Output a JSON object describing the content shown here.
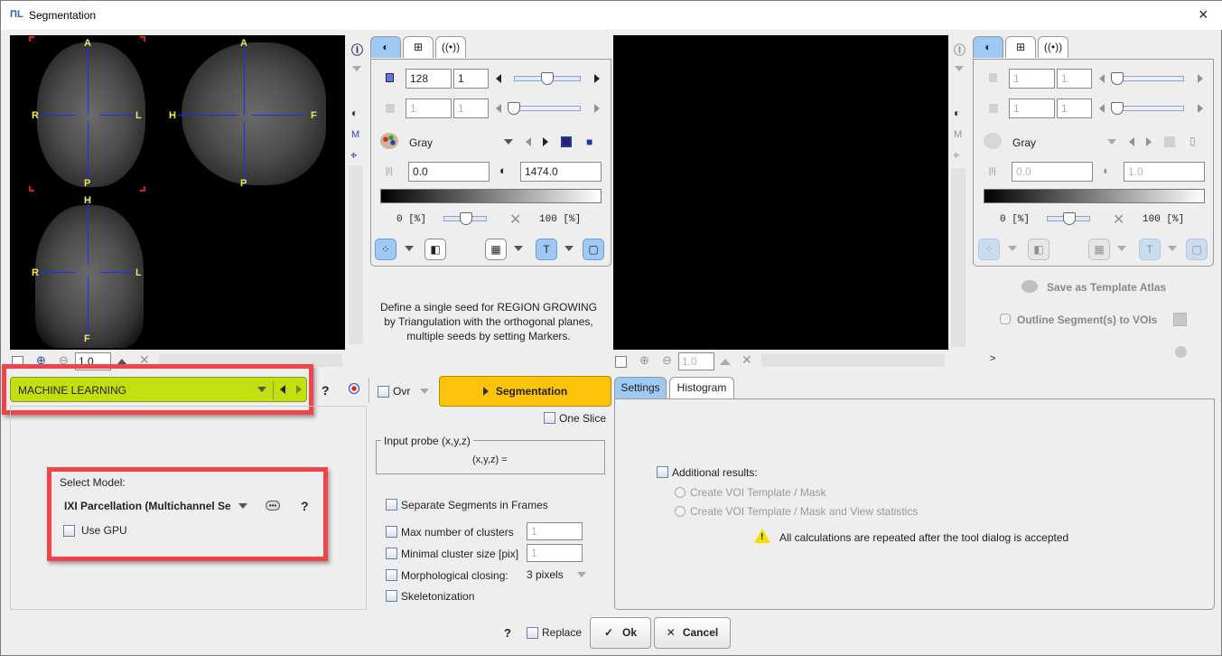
{
  "window": {
    "title": "Segmentation",
    "icon": "pmod-logo-icon",
    "close": "×"
  },
  "left_viewer": {
    "orientation_labels": {
      "axial": {
        "top": "A",
        "bottom": "P",
        "left": "R",
        "right": "L"
      },
      "sagittal": {
        "top": "A",
        "bottom": "P",
        "left": "H",
        "right": "F"
      },
      "coronal": {
        "top": "H",
        "bottom": "F",
        "left": "R",
        "right": "L"
      }
    },
    "zoom_value": "1.0"
  },
  "left_controls": {
    "tabs": [
      {
        "icon": "contrast-icon",
        "active": true
      },
      {
        "icon": "layout-icon"
      },
      {
        "icon": "fusion-icon"
      }
    ],
    "slice_value": "128",
    "slice_step": "1",
    "slice_slider_fraction": 0.62,
    "frame_value": "1",
    "frame_step": "1",
    "colormap": "Gray",
    "min_value": "0.0",
    "max_value": "1474.0",
    "pct_min": "0 [%]",
    "pct_max": "100 [%]",
    "pct_slider_fraction": 0.55
  },
  "hint_text": [
    "Define a single seed for REGION GROWING",
    "by Triangulation with the orthogonal planes,",
    "multiple seeds by setting Markers."
  ],
  "right_viewer": {
    "zoom_value": "1.0"
  },
  "right_controls": {
    "tabs": [
      {
        "icon": "contrast-icon",
        "active": true
      },
      {
        "icon": "layout-icon"
      },
      {
        "icon": "fusion-icon"
      }
    ],
    "slice_value": "1",
    "slice_step": "1",
    "frame_value": "1",
    "frame_step": "1",
    "colormap": "Gray",
    "min_value": "0.0",
    "max_value": "1.0",
    "pct_min": "0 [%]",
    "pct_max": "100 [%]",
    "save_template_label": "Save as Template Atlas",
    "outline_label": "Outline Segment(s) to VOIs",
    "expand_label": ">"
  },
  "method": {
    "selected": "MACHINE LEARNING",
    "color": "#c3df0f",
    "help": "?"
  },
  "ovr_label": "Ovr",
  "segmentation_button": "Segmentation",
  "one_slice_label": "One Slice",
  "model": {
    "label": "Select Model:",
    "selected": "IXI Parcellation (Multichannel Seg",
    "help": "?",
    "use_gpu_label": "Use GPU"
  },
  "input_probe": {
    "legend": "Input probe (x,y,z)",
    "value": "(x,y,z) ="
  },
  "options": {
    "separate_frames": "Separate Segments in Frames",
    "max_clusters": {
      "label": "Max number of clusters",
      "value": "1"
    },
    "min_cluster": {
      "label": "Minimal cluster size [pix]",
      "value": "1"
    },
    "closing": {
      "label": "Morphological closing:",
      "value": "3 pixels"
    },
    "skeleton": "Skeletonization"
  },
  "result_tabs": [
    {
      "label": "Settings",
      "active": true
    },
    {
      "label": "Histogram"
    }
  ],
  "results": {
    "additional_label": "Additional results:",
    "radio1": "Create VOI Template / Mask",
    "radio2": "Create VOI Template / Mask and View statistics",
    "warning": "All calculations are repeated after the tool dialog is accepted"
  },
  "footer": {
    "help": "?",
    "replace_label": "Replace",
    "ok_label": "Ok",
    "cancel_label": "Cancel"
  }
}
